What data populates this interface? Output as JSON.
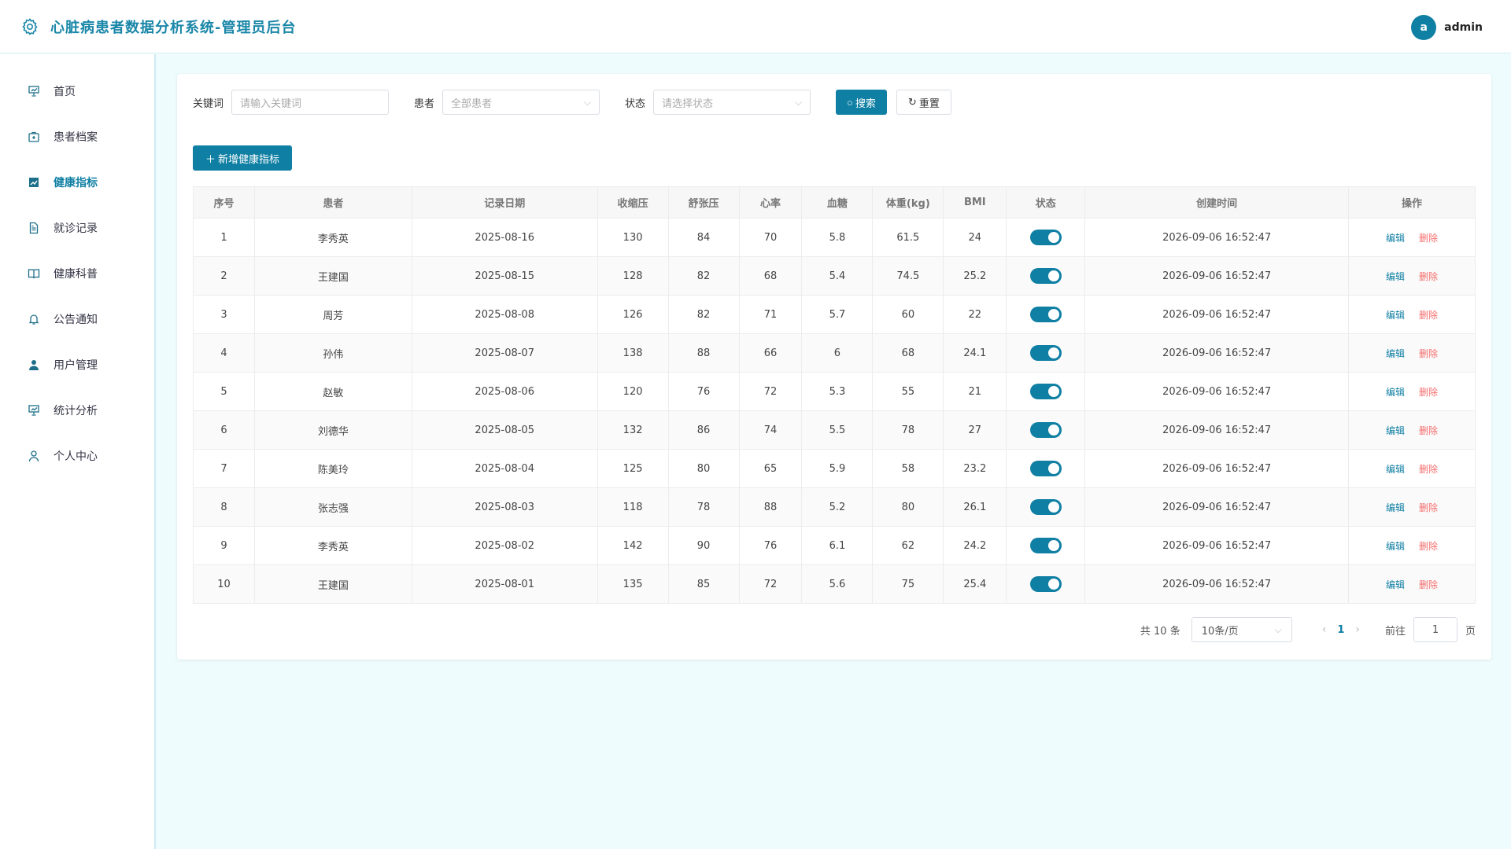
{
  "header": {
    "title": "心脏病患者数据分析系统-管理员后台",
    "avatar_letter": "a",
    "username": "admin"
  },
  "sidebar": {
    "items": [
      {
        "label": "首页",
        "icon": "presentation-icon"
      },
      {
        "label": "患者档案",
        "icon": "medical-kit-icon"
      },
      {
        "label": "健康指标",
        "icon": "chart-icon",
        "active": true
      },
      {
        "label": "就诊记录",
        "icon": "document-icon"
      },
      {
        "label": "健康科普",
        "icon": "book-icon"
      },
      {
        "label": "公告通知",
        "icon": "bell-icon"
      },
      {
        "label": "用户管理",
        "icon": "user-filled-icon"
      },
      {
        "label": "统计分析",
        "icon": "presentation-icon"
      },
      {
        "label": "个人中心",
        "icon": "user-icon"
      }
    ]
  },
  "filters": {
    "keyword_label": "关键词",
    "keyword_placeholder": "请输入关键词",
    "patient_label": "患者",
    "patient_value": "全部患者",
    "status_label": "状态",
    "status_placeholder": "请选择状态",
    "search_label": "搜索",
    "reset_label": "重置"
  },
  "add_button": "新增健康指标",
  "table": {
    "headers": [
      "序号",
      "患者",
      "记录日期",
      "收缩压",
      "舒张压",
      "心率",
      "血糖",
      "体重(kg)",
      "BMI",
      "状态",
      "创建时间",
      "操作"
    ],
    "edit_label": "编辑",
    "delete_label": "删除",
    "rows": [
      {
        "idx": "1",
        "patient": "李秀英",
        "date": "2025-08-16",
        "sbp": "130",
        "dbp": "84",
        "hr": "70",
        "glucose": "5.8",
        "weight": "61.5",
        "bmi": "24",
        "status_on": true,
        "created": "2026-09-06 16:52:47"
      },
      {
        "idx": "2",
        "patient": "王建国",
        "date": "2025-08-15",
        "sbp": "128",
        "dbp": "82",
        "hr": "68",
        "glucose": "5.4",
        "weight": "74.5",
        "bmi": "25.2",
        "status_on": true,
        "created": "2026-09-06 16:52:47"
      },
      {
        "idx": "3",
        "patient": "周芳",
        "date": "2025-08-08",
        "sbp": "126",
        "dbp": "82",
        "hr": "71",
        "glucose": "5.7",
        "weight": "60",
        "bmi": "22",
        "status_on": true,
        "created": "2026-09-06 16:52:47"
      },
      {
        "idx": "4",
        "patient": "孙伟",
        "date": "2025-08-07",
        "sbp": "138",
        "dbp": "88",
        "hr": "66",
        "glucose": "6",
        "weight": "68",
        "bmi": "24.1",
        "status_on": true,
        "created": "2026-09-06 16:52:47"
      },
      {
        "idx": "5",
        "patient": "赵敏",
        "date": "2025-08-06",
        "sbp": "120",
        "dbp": "76",
        "hr": "72",
        "glucose": "5.3",
        "weight": "55",
        "bmi": "21",
        "status_on": true,
        "created": "2026-09-06 16:52:47"
      },
      {
        "idx": "6",
        "patient": "刘德华",
        "date": "2025-08-05",
        "sbp": "132",
        "dbp": "86",
        "hr": "74",
        "glucose": "5.5",
        "weight": "78",
        "bmi": "27",
        "status_on": true,
        "created": "2026-09-06 16:52:47"
      },
      {
        "idx": "7",
        "patient": "陈美玲",
        "date": "2025-08-04",
        "sbp": "125",
        "dbp": "80",
        "hr": "65",
        "glucose": "5.9",
        "weight": "58",
        "bmi": "23.2",
        "status_on": true,
        "created": "2026-09-06 16:52:47"
      },
      {
        "idx": "8",
        "patient": "张志强",
        "date": "2025-08-03",
        "sbp": "118",
        "dbp": "78",
        "hr": "88",
        "glucose": "5.2",
        "weight": "80",
        "bmi": "26.1",
        "status_on": true,
        "created": "2026-09-06 16:52:47"
      },
      {
        "idx": "9",
        "patient": "李秀英",
        "date": "2025-08-02",
        "sbp": "142",
        "dbp": "90",
        "hr": "76",
        "glucose": "6.1",
        "weight": "62",
        "bmi": "24.2",
        "status_on": true,
        "created": "2026-09-06 16:52:47"
      },
      {
        "idx": "10",
        "patient": "王建国",
        "date": "2025-08-01",
        "sbp": "135",
        "dbp": "85",
        "hr": "72",
        "glucose": "5.6",
        "weight": "75",
        "bmi": "25.4",
        "status_on": true,
        "created": "2026-09-06 16:52:47"
      }
    ]
  },
  "pagination": {
    "total_text": "共 10 条",
    "page_size": "10条/页",
    "current_page": "1",
    "goto_label": "前往",
    "goto_value": "1",
    "page_suffix": "页"
  },
  "colors": {
    "accent": "#0f7fa3",
    "danger": "#f56c6c",
    "background": "#eefcfe"
  }
}
